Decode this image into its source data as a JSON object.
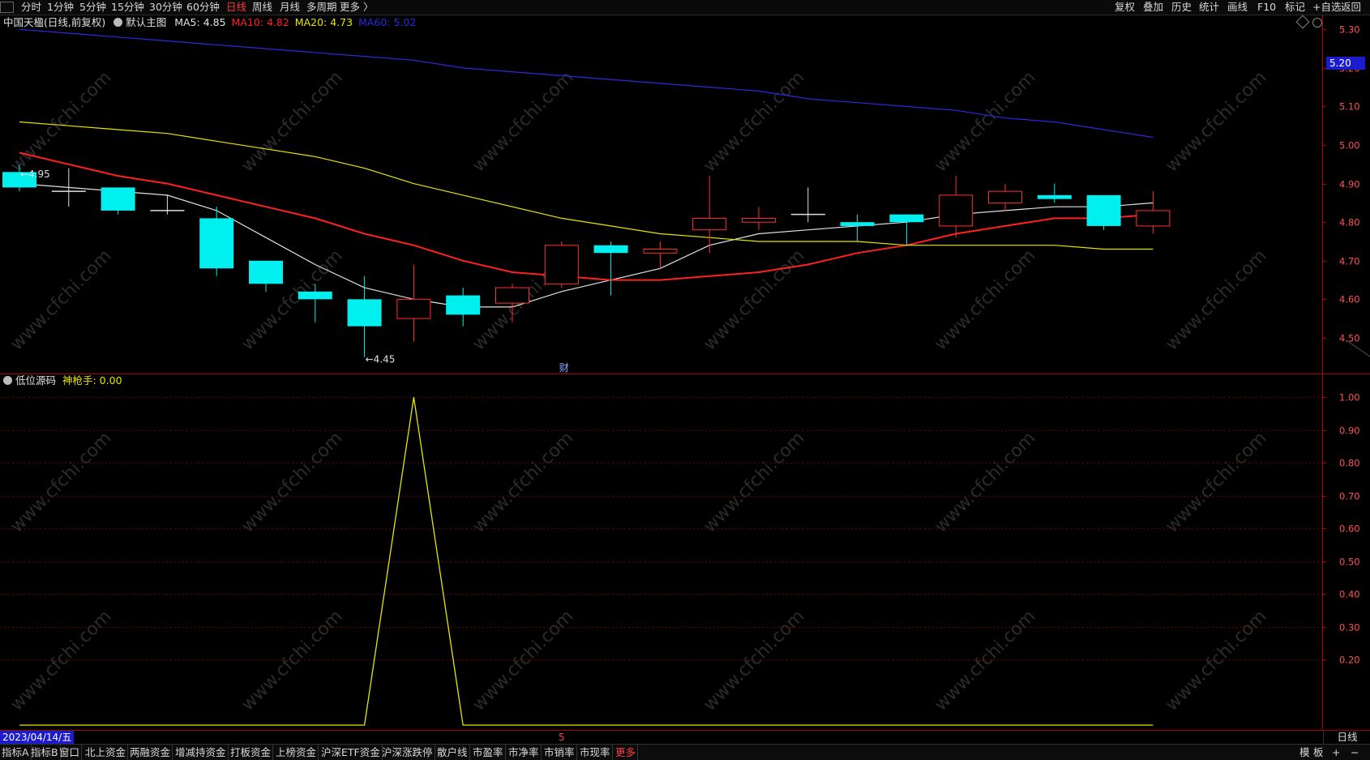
{
  "top_toolbar": {
    "left_tabs": [
      "分时",
      "1分钟",
      "5分钟",
      "15分钟",
      "30分钟",
      "60分钟",
      "日线",
      "周线",
      "月线",
      "多周期",
      "更多 〉"
    ],
    "active_tab": "日线",
    "right_tabs": [
      "复权",
      "叠加",
      "历史",
      "统计",
      "画线",
      "F10",
      "标记",
      "+自选",
      "返回"
    ]
  },
  "main_panel": {
    "stock_title": "中国天楹(日线,前复权)",
    "template_label": "默认主图",
    "ma_values": [
      {
        "label": "MA5: 4.85",
        "color": "#e0e0e0"
      },
      {
        "label": "MA10: 4.82",
        "color": "#ff2020"
      },
      {
        "label": "MA20: 4.73",
        "color": "#e6e600"
      },
      {
        "label": "MA60: 5.02",
        "color": "#2a2ae0"
      }
    ],
    "high_marker": "4.95",
    "low_marker": "4.45",
    "finance_marker": "财",
    "price_tag": "5.20",
    "y_axis": [
      "5.30",
      "5.20",
      "5.10",
      "5.00",
      "4.90",
      "4.80",
      "4.70",
      "4.60",
      "4.50"
    ]
  },
  "indicator_panel": {
    "name": "低位源码",
    "value_label": "神枪手: 0.00",
    "y_axis": [
      "1.00",
      "0.90",
      "0.80",
      "0.70",
      "0.60",
      "0.50",
      "0.40",
      "0.30",
      "0.20"
    ]
  },
  "date_bar": {
    "date": "2023/04/14/五",
    "month_mark": "5",
    "period": "日线"
  },
  "bottom_toolbar": {
    "tabs": [
      "指标A",
      "指标B",
      "窗口",
      "北上资金",
      "两融资金",
      "增减持资金",
      "打板资金",
      "上榜资金",
      "沪深ETF资金",
      "沪深涨跌停",
      "散户线",
      "市盈率",
      "市净率",
      "市销率",
      "市现率",
      "更多"
    ],
    "right_controls": [
      "模",
      "板",
      "+",
      "−"
    ]
  },
  "watermark": "www.cfchi.com",
  "chart_data": [
    {
      "type": "candlestick",
      "title": "中国天楹(日线,前复权)",
      "ylim": [
        4.42,
        5.33
      ],
      "up_color": "#ff3030",
      "down_color": "#00f0f0",
      "candles": [
        {
          "o": 4.93,
          "h": 4.95,
          "l": 4.88,
          "c": 4.89
        },
        {
          "o": 4.88,
          "h": 4.94,
          "l": 4.84,
          "c": 4.88
        },
        {
          "o": 4.89,
          "h": 4.89,
          "l": 4.82,
          "c": 4.83
        },
        {
          "o": 4.83,
          "h": 4.87,
          "l": 4.82,
          "c": 4.83
        },
        {
          "o": 4.81,
          "h": 4.84,
          "l": 4.66,
          "c": 4.68
        },
        {
          "o": 4.7,
          "h": 4.7,
          "l": 4.62,
          "c": 4.64
        },
        {
          "o": 4.62,
          "h": 4.64,
          "l": 4.54,
          "c": 4.6
        },
        {
          "o": 4.6,
          "h": 4.66,
          "l": 4.45,
          "c": 4.53
        },
        {
          "o": 4.55,
          "h": 4.69,
          "l": 4.49,
          "c": 4.6
        },
        {
          "o": 4.61,
          "h": 4.63,
          "l": 4.53,
          "c": 4.56
        },
        {
          "o": 4.59,
          "h": 4.64,
          "l": 4.54,
          "c": 4.63
        },
        {
          "o": 4.64,
          "h": 4.75,
          "l": 4.63,
          "c": 4.74
        },
        {
          "o": 4.74,
          "h": 4.75,
          "l": 4.61,
          "c": 4.72
        },
        {
          "o": 4.72,
          "h": 4.75,
          "l": 4.68,
          "c": 4.73
        },
        {
          "o": 4.78,
          "h": 4.92,
          "l": 4.72,
          "c": 4.81
        },
        {
          "o": 4.8,
          "h": 4.84,
          "l": 4.78,
          "c": 4.81
        },
        {
          "o": 4.82,
          "h": 4.89,
          "l": 4.8,
          "c": 4.82
        },
        {
          "o": 4.8,
          "h": 4.82,
          "l": 4.75,
          "c": 4.79
        },
        {
          "o": 4.82,
          "h": 4.82,
          "l": 4.74,
          "c": 4.8
        },
        {
          "o": 4.79,
          "h": 4.92,
          "l": 4.76,
          "c": 4.87
        },
        {
          "o": 4.85,
          "h": 4.9,
          "l": 4.83,
          "c": 4.88
        },
        {
          "o": 4.87,
          "h": 4.9,
          "l": 4.85,
          "c": 4.86
        },
        {
          "o": 4.87,
          "h": 4.87,
          "l": 4.78,
          "c": 4.79
        },
        {
          "o": 4.79,
          "h": 4.88,
          "l": 4.77,
          "c": 4.83
        }
      ],
      "series": [
        {
          "name": "MA5",
          "color": "#e0e0e0",
          "values": [
            4.9,
            4.89,
            4.88,
            4.87,
            4.83,
            4.76,
            4.69,
            4.63,
            4.6,
            4.58,
            4.58,
            4.62,
            4.65,
            4.68,
            4.74,
            4.77,
            4.78,
            4.79,
            4.8,
            4.82,
            4.83,
            4.84,
            4.84,
            4.85
          ]
        },
        {
          "name": "MA10",
          "color": "#ff2020",
          "values": [
            4.98,
            4.95,
            4.92,
            4.9,
            4.87,
            4.84,
            4.81,
            4.77,
            4.74,
            4.7,
            4.67,
            4.66,
            4.65,
            4.65,
            4.66,
            4.67,
            4.69,
            4.72,
            4.74,
            4.77,
            4.79,
            4.81,
            4.81,
            4.82
          ]
        },
        {
          "name": "MA20",
          "color": "#e6e600",
          "values": [
            5.06,
            5.05,
            5.04,
            5.03,
            5.01,
            4.99,
            4.97,
            4.94,
            4.9,
            4.87,
            4.84,
            4.81,
            4.79,
            4.77,
            4.76,
            4.75,
            4.75,
            4.75,
            4.74,
            4.74,
            4.74,
            4.74,
            4.73,
            4.73
          ]
        },
        {
          "name": "MA60",
          "color": "#2a2ae0",
          "values": [
            5.3,
            5.29,
            5.28,
            5.27,
            5.26,
            5.25,
            5.24,
            5.23,
            5.22,
            5.2,
            5.19,
            5.18,
            5.17,
            5.16,
            5.15,
            5.14,
            5.12,
            5.11,
            5.1,
            5.09,
            5.07,
            5.06,
            5.04,
            5.02
          ]
        }
      ]
    },
    {
      "type": "line",
      "title": "低位源码",
      "ylim": [
        0.0,
        1.05
      ],
      "series": [
        {
          "name": "神枪手",
          "color": "#e6e600",
          "values": [
            0,
            0,
            0,
            0,
            0,
            0,
            0,
            0,
            1,
            0,
            0,
            0,
            0,
            0,
            0,
            0,
            0,
            0,
            0,
            0,
            0,
            0,
            0,
            0
          ]
        }
      ]
    }
  ]
}
